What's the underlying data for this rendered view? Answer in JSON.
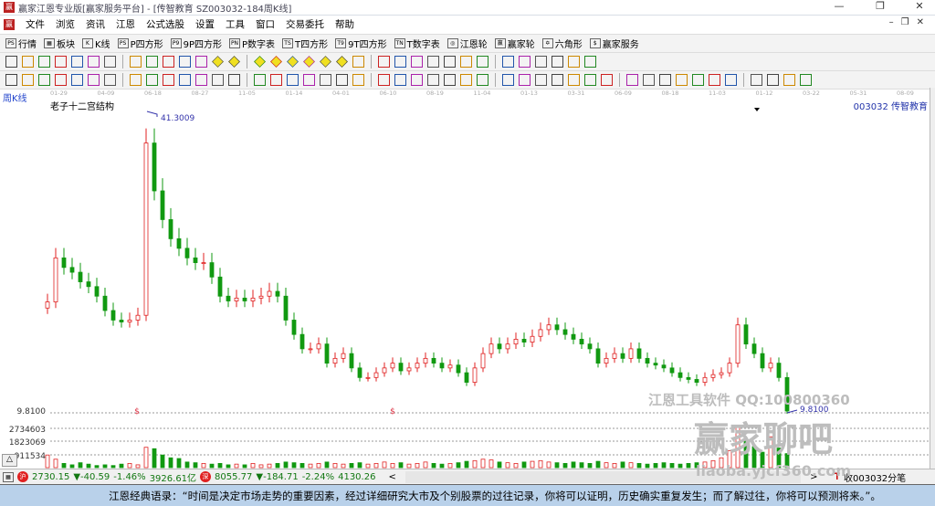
{
  "window": {
    "title": "赢家江恩专业版[赢家服务平台] - [传智教育  SZ003032-184周K线]",
    "minimize": "—",
    "restore": "❐",
    "close": "✕"
  },
  "menu": [
    "文件",
    "浏览",
    "资讯",
    "江恩",
    "公式选股",
    "设置",
    "工具",
    "窗口",
    "交易委托",
    "帮助"
  ],
  "mdi_controls": "–❐✕",
  "toolbar": [
    {
      "icon": "PS",
      "label": "行情"
    },
    {
      "icon": "▦",
      "label": "板块"
    },
    {
      "icon": "K",
      "label": "K线"
    },
    {
      "icon": "PS",
      "label": "P四方形"
    },
    {
      "icon": "P9",
      "label": "9P四方形"
    },
    {
      "icon": "PN",
      "label": "P数字表"
    },
    {
      "icon": "TS",
      "label": "T四方形"
    },
    {
      "icon": "T9",
      "label": "9T四方形"
    },
    {
      "icon": "TN",
      "label": "T数字表"
    },
    {
      "icon": "◎",
      "label": "江恩轮"
    },
    {
      "icon": "赢",
      "label": "赢家轮"
    },
    {
      "icon": "✡",
      "label": "六角形"
    },
    {
      "icon": "$",
      "label": "赢家服务"
    }
  ],
  "period": "周K线",
  "indicator_name": "老子十二宫结构",
  "stock": "003032  传智教育",
  "date_ticks": [
    "01-29",
    "04-09",
    "06-18",
    "08-27",
    "11-05",
    "01-14",
    "04-01",
    "06-10",
    "08-19",
    "11-04",
    "01-13",
    "03-31",
    "06-09",
    "08-18",
    "11-03",
    "01-12",
    "03-22",
    "05-31",
    "08-09"
  ],
  "chart_data": {
    "type": "candlestick",
    "high_label": "41.3009",
    "low_label": "9.8100",
    "ylim": [
      9.81,
      41.3009
    ],
    "y_price_label": "9.8100",
    "volume_ticks": [
      "2734603",
      "1823069",
      "911534"
    ],
    "volume_ylim": [
      0,
      3200000
    ],
    "closes": [
      21.4,
      26,
      25,
      24.5,
      23.5,
      23,
      22,
      20.5,
      19.5,
      19.3,
      19.5,
      20,
      38,
      33,
      30,
      28,
      27,
      26,
      25.5,
      25.5,
      24,
      22,
      21.5,
      21.8,
      21.5,
      21.8,
      22,
      22.5,
      22,
      19.5,
      18,
      16.5,
      16.5,
      17,
      15,
      15.5,
      16,
      14.5,
      13.5,
      13.5,
      14,
      14.5,
      15,
      14.2,
      14.5,
      15,
      15.5,
      15,
      14.5,
      14.8,
      14,
      13,
      14.5,
      16,
      17,
      16.5,
      17,
      17.5,
      17.2,
      17.8,
      18.5,
      19,
      18.5,
      18,
      17.5,
      17,
      16.5,
      15,
      15.5,
      16,
      15.5,
      16.5,
      15.5,
      15,
      14.8,
      14.5,
      14,
      13.5,
      13.3,
      13,
      13.5,
      13.8,
      14,
      15,
      19,
      17,
      16,
      14.5,
      15,
      13.5,
      10
    ],
    "volumes": [
      900000,
      600000,
      300000,
      200000,
      350000,
      250000,
      150000,
      200000,
      150000,
      250000,
      300000,
      200000,
      1450000,
      1350000,
      900000,
      700000,
      650000,
      400000,
      350000,
      300000,
      250000,
      300000,
      200000,
      250000,
      200000,
      300000,
      200000,
      250000,
      300000,
      400000,
      350000,
      300000,
      250000,
      300000,
      400000,
      300000,
      250000,
      300000,
      350000,
      250000,
      300000,
      400000,
      300000,
      350000,
      250000,
      300000,
      400000,
      300000,
      250000,
      300000,
      350000,
      450000,
      500000,
      600000,
      550000,
      400000,
      350000,
      300000,
      400000,
      450000,
      500000,
      400000,
      350000,
      300000,
      400000,
      350000,
      300000,
      450000,
      350000,
      300000,
      400000,
      350000,
      300000,
      250000,
      300000,
      350000,
      300000,
      250000,
      300000,
      350000,
      400000,
      500000,
      700000,
      1200000,
      2900000,
      2000000,
      1500000,
      1100000,
      2200000,
      1400000,
      1000000
    ],
    "markers": [
      "$",
      "$"
    ]
  },
  "watermark": {
    "line1": "江恩工具软件  QQ:100800360",
    "line2": "赢家聊吧",
    "line3": "liaoba.yjcf360.com"
  },
  "status": {
    "sh_icon": "沪",
    "sh": "2730.15",
    "sh_chg": "▼-40.59",
    "sh_pct": "-1.46%",
    "sh_amt": "3926.61亿",
    "sz_icon": "深",
    "sz": "8055.77",
    "sz_chg": "▼-184.71",
    "sz_pct": "-2.24%",
    "sz_amt": "4130.26",
    "scroll_left": "<",
    "scroll_right": ">",
    "right": "收003032分笔",
    "collapse": "△"
  },
  "quote": "江恩经典语录：“时间是决定市场走势的重要因素，经过详细研究大市及个别股票的过往记录，你将可以证明，历史确实重复发生；而了解过往，你将可以预测将来。”。"
}
